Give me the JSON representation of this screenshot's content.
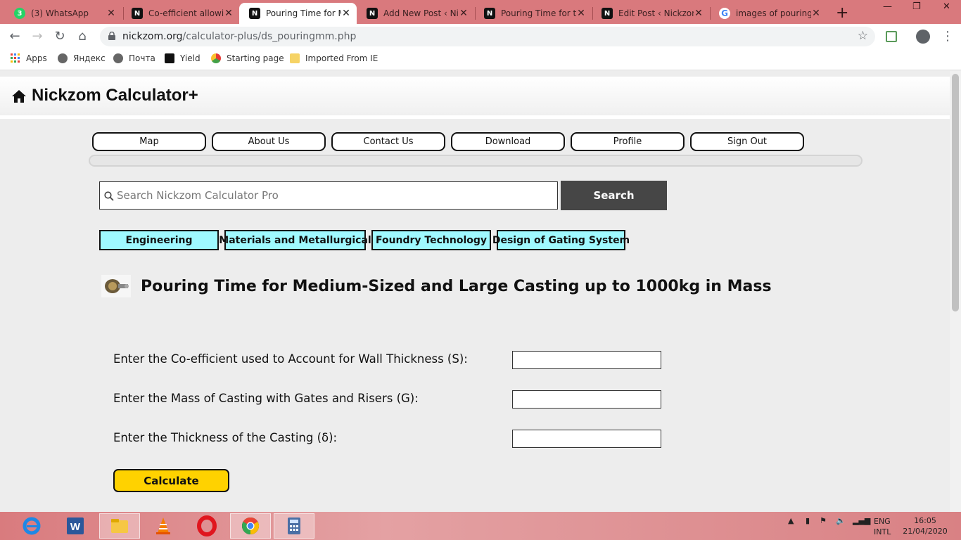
{
  "tabs": [
    {
      "title": "(3) WhatsApp",
      "icon": "whatsapp-icon",
      "fav": "3"
    },
    {
      "title": "Co-efficient allowing",
      "icon": "nickzom-icon",
      "fav": "N"
    },
    {
      "title": "Pouring Time for M",
      "icon": "nickzom-icon",
      "fav": "N"
    },
    {
      "title": "Add New Post ‹ Nic",
      "icon": "nickzom-icon",
      "fav": "N"
    },
    {
      "title": "Pouring Time for th",
      "icon": "nickzom-icon",
      "fav": "N"
    },
    {
      "title": "Edit Post ‹ Nickzom",
      "icon": "nickzom-icon",
      "fav": "N"
    },
    {
      "title": "images of pouring",
      "icon": "google-icon",
      "fav": "G"
    }
  ],
  "address": {
    "domain": "nickzom.org",
    "path": "/calculator-plus/ds_pouringmm.php"
  },
  "bookmarks": [
    "Apps",
    "Яндекс",
    "Почта",
    "Yield",
    "Starting page",
    "Imported From IE"
  ],
  "site": {
    "brand": "Nickzom Calculator+"
  },
  "nav": [
    "Map",
    "About Us",
    "Contact Us",
    "Download",
    "Profile",
    "Sign Out"
  ],
  "search": {
    "placeholder": "Search Nickzom Calculator Pro",
    "button": "Search"
  },
  "breadcrumbs": [
    "Engineering",
    "Materials and Metallurgical",
    "Foundry Technology",
    "Design of Gating System"
  ],
  "page_title": "Pouring Time for Medium-Sized and Large Casting up to 1000kg in Mass",
  "form": {
    "fields": [
      {
        "label": "Enter the Co-efficient used to Account for Wall Thickness (S):",
        "value": ""
      },
      {
        "label": "Enter the Mass of Casting with Gates and Risers (G):",
        "value": ""
      },
      {
        "label": "Enter the Thickness of the Casting (δ):",
        "value": ""
      }
    ],
    "calculate": "Calculate"
  },
  "tray": {
    "lang1": "ENG",
    "lang2": "INTL",
    "time": "16:05",
    "date": "21/04/2020"
  }
}
